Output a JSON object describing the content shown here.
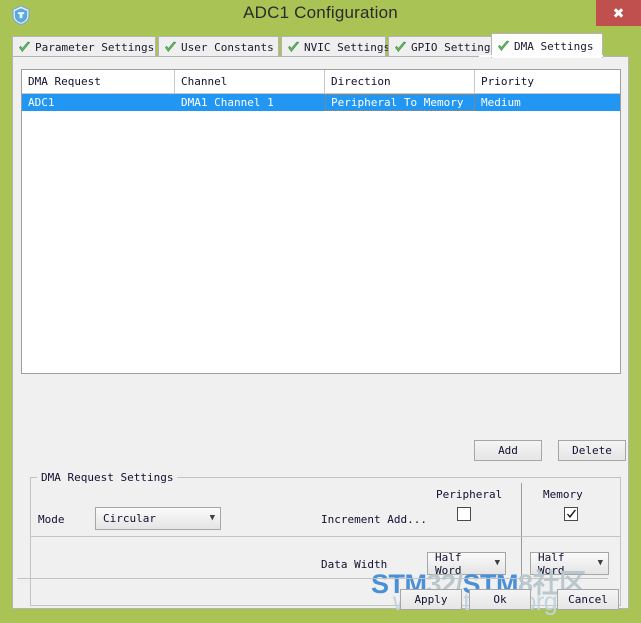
{
  "window": {
    "title": "ADC1 Configuration",
    "icon": "shield-icon",
    "close_label": "✖",
    "accent_color": "#a9c455",
    "close_color": "#c0504d"
  },
  "tabs": [
    {
      "label": "Parameter Settings",
      "icon": "green-check-icon",
      "active": false
    },
    {
      "label": "User Constants",
      "icon": "green-check-icon",
      "active": false
    },
    {
      "label": "NVIC Settings",
      "icon": "green-check-icon",
      "active": false
    },
    {
      "label": "GPIO Settings",
      "icon": "green-check-icon",
      "active": false
    },
    {
      "label": "DMA Settings",
      "icon": "green-check-icon",
      "active": true
    }
  ],
  "table": {
    "columns": [
      "DMA Request",
      "Channel",
      "Direction",
      "Priority"
    ],
    "rows": [
      {
        "dma_request": "ADC1",
        "channel": "DMA1 Channel 1",
        "direction": "Peripheral To Memory",
        "priority": "Medium",
        "selected": true,
        "focused_cell": "direction"
      }
    ],
    "selection_color": "#2196f3",
    "focus_border_color": "#c08040"
  },
  "actions": {
    "add_label": "Add",
    "delete_label": "Delete"
  },
  "request_settings": {
    "group_title": "DMA Request Settings",
    "mode_label": "Mode",
    "mode_value": "Circular",
    "peripheral_header": "Peripheral",
    "memory_header": "Memory",
    "increment_label": "Increment Add...",
    "peripheral_increment_checked": "false",
    "memory_increment_checked": "true",
    "data_width_label": "Data Width",
    "peripheral_data_width": "Half Word",
    "memory_data_width": "Half Word"
  },
  "footer": {
    "apply_label": "Apply",
    "ok_label": "Ok",
    "cancel_label": "Cancel"
  },
  "watermark": {
    "line1_a": "STM",
    "line1_b": "32/",
    "line1_c": "STM",
    "line1_d": "8社区",
    "line2": "www.stmcu.org"
  }
}
